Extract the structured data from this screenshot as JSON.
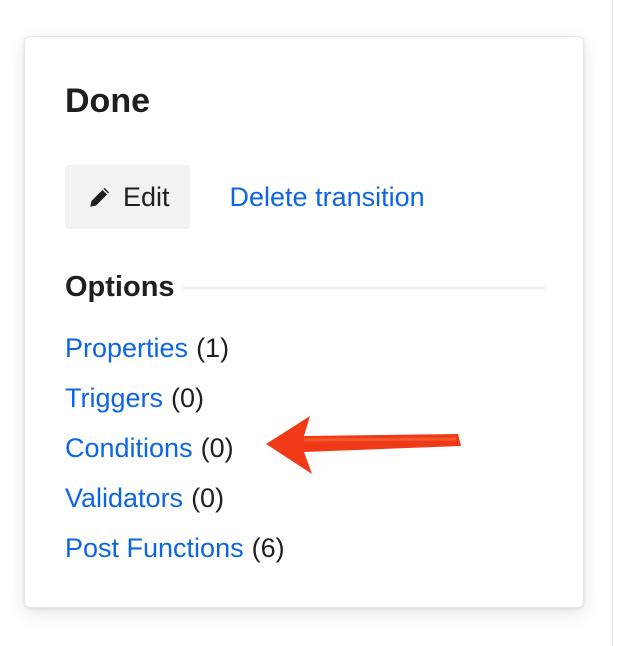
{
  "card": {
    "title": "Done",
    "edit_label": "Edit",
    "delete_label": "Delete transition"
  },
  "options": {
    "heading": "Options",
    "items": [
      {
        "label": "Properties",
        "count": "(1)"
      },
      {
        "label": "Triggers",
        "count": "(0)"
      },
      {
        "label": "Conditions",
        "count": "(0)"
      },
      {
        "label": "Validators",
        "count": "(0)"
      },
      {
        "label": "Post Functions",
        "count": "(6)"
      }
    ]
  },
  "icons": {
    "edit": "pencil-icon",
    "annotation": "arrow-left-annotation"
  },
  "colors": {
    "link": "#0c66e4",
    "text": "#1f1f1f",
    "button_bg": "#f1f2f4",
    "annotation": "#f03a17"
  }
}
